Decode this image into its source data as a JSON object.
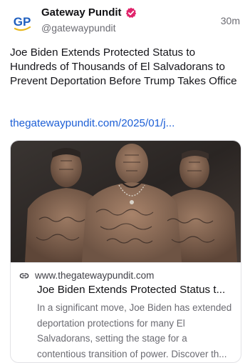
{
  "author": {
    "name": "Gateway Pundit",
    "handle": "@gatewaypundit",
    "avatar_text": "GP",
    "verified": true
  },
  "post": {
    "timestamp": "30m",
    "text": "Joe Biden Extends Protected Status to Hundreds of Thousands of El Salvadorans to Prevent Deportation Before Trump Takes Office",
    "link": "thegatewaypundit.com/2025/01/j..."
  },
  "card": {
    "domain": "www.thegatewaypundit.com",
    "title": "Joe Biden Extends Protected Status t...",
    "description": "In a significant move, Joe Biden has extended deportation protections for many El Salvadorans, setting the stage for a contentious transition of power. Discover th..."
  },
  "colors": {
    "link": "#1d5fd6",
    "verified_badge": "#e0246b",
    "logo_gp": "#1f5fbf",
    "logo_swoosh": "#e8b81f"
  },
  "icons": {
    "verified": "verified-badge-icon",
    "link": "link-icon"
  }
}
